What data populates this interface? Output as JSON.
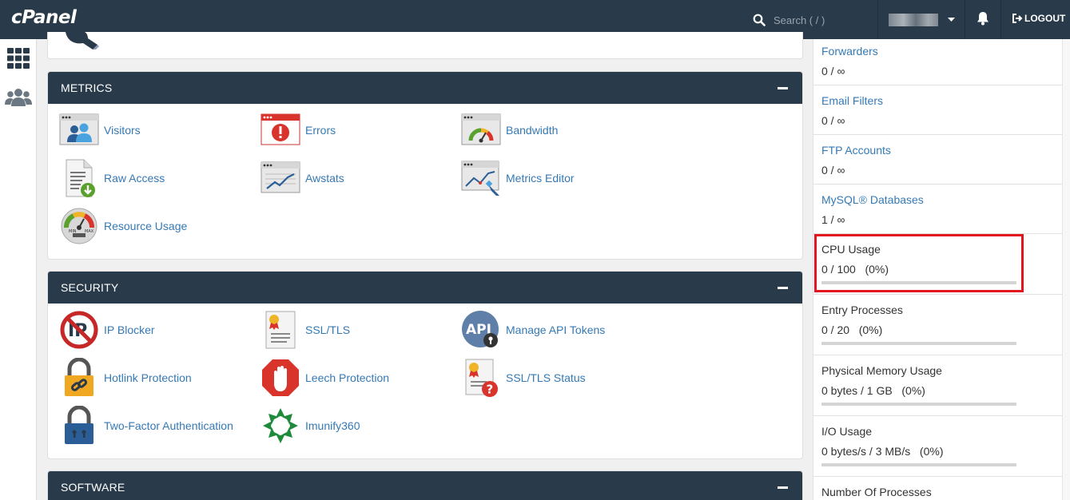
{
  "header": {
    "logo": "cPanel",
    "search_placeholder": "Search ( / )",
    "logout_label": "LOGOUT"
  },
  "sections": {
    "metrics": {
      "title": "METRICS",
      "items": [
        "Visitors",
        "Errors",
        "Bandwidth",
        "Raw Access",
        "Awstats",
        "Metrics Editor",
        "Resource Usage"
      ]
    },
    "security": {
      "title": "SECURITY",
      "items": [
        "IP Blocker",
        "SSL/TLS",
        "Manage API Tokens",
        "Hotlink Protection",
        "Leech Protection",
        "SSL/TLS Status",
        "Two-Factor Authentication",
        "Imunify360"
      ]
    },
    "software": {
      "title": "SOFTWARE"
    }
  },
  "stats": [
    {
      "name": "Forwarders",
      "value": "0 / ∞"
    },
    {
      "name": "Email Filters",
      "value": "0 / ∞"
    },
    {
      "name": "FTP Accounts",
      "value": "0 / ∞"
    },
    {
      "name": "MySQL® Databases",
      "value": "1 / ∞"
    },
    {
      "name": "CPU Usage",
      "value": "0 / 100   (0%)",
      "percent": 0
    },
    {
      "name": "Entry Processes",
      "value": "0 / 20   (0%)",
      "percent": 0
    },
    {
      "name": "Physical Memory Usage",
      "value": "0 bytes / 1 GB   (0%)",
      "percent": 0
    },
    {
      "name": "I/O Usage",
      "value": "0 bytes/s / 3 MB/s   (0%)",
      "percent": 0
    },
    {
      "name": "Number Of Processes"
    }
  ],
  "colors": {
    "header_bg": "#293a4a",
    "link": "#3579b5",
    "highlight": "#e3141f"
  }
}
